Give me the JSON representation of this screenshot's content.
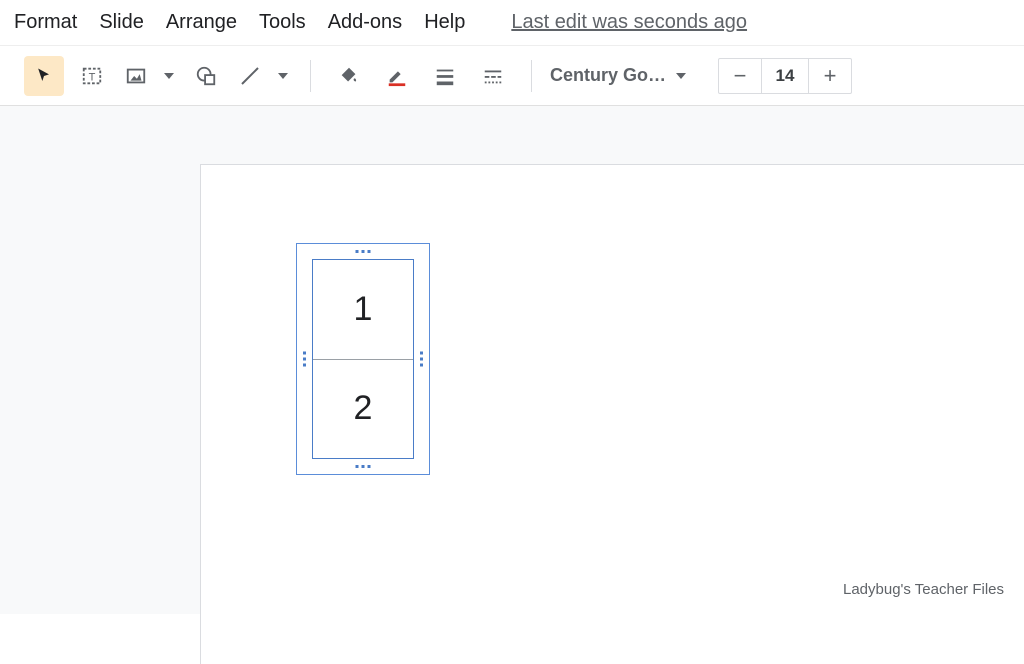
{
  "menu": {
    "items": [
      "Format",
      "Slide",
      "Arrange",
      "Tools",
      "Add-ons",
      "Help"
    ],
    "last_edit": "Last edit was seconds ago"
  },
  "toolbar": {
    "font_name": "Century Go…",
    "font_size": "14"
  },
  "slide": {
    "table": {
      "cells": [
        "1",
        "2"
      ]
    }
  },
  "watermark": "Ladybug's Teacher Files"
}
